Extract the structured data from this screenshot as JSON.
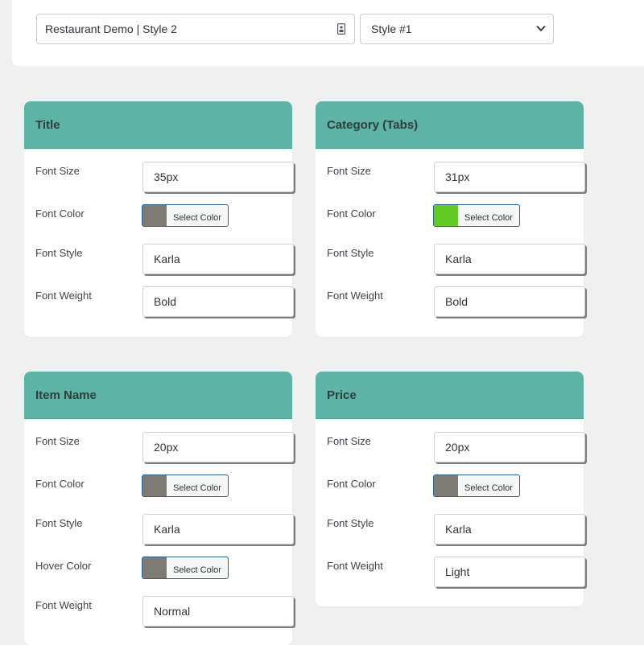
{
  "header": {
    "name_value": "Restaurant Demo | Style 2",
    "style_select_value": "Style #1"
  },
  "colors": {
    "accent_header": "#5db3a6",
    "swatch_gray": "#7f7c78",
    "swatch_green": "#62c925"
  },
  "select_color_label": "Select Color",
  "cards": {
    "title": {
      "heading": "Title",
      "font_size_label": "Font Size",
      "font_size_value": "35px",
      "font_color_label": "Font Color",
      "font_style_label": "Font Style",
      "font_style_value": "Karla",
      "font_weight_label": "Font Weight",
      "font_weight_value": "Bold"
    },
    "category": {
      "heading": "Category (Tabs)",
      "font_size_label": "Font Size",
      "font_size_value": "31px",
      "font_color_label": "Font Color",
      "font_style_label": "Font Style",
      "font_style_value": "Karla",
      "font_weight_label": "Font Weight",
      "font_weight_value": "Bold"
    },
    "item_name": {
      "heading": "Item Name",
      "font_size_label": "Font Size",
      "font_size_value": "20px",
      "font_color_label": "Font Color",
      "font_style_label": "Font Style",
      "font_style_value": "Karla",
      "hover_color_label": "Hover Color",
      "font_weight_label": "Font Weight",
      "font_weight_value": "Normal"
    },
    "price": {
      "heading": "Price",
      "font_size_label": "Font Size",
      "font_size_value": "20px",
      "font_color_label": "Font Color",
      "font_style_label": "Font Style",
      "font_style_value": "Karla",
      "font_weight_label": "Font Weight",
      "font_weight_value": "Light"
    }
  }
}
